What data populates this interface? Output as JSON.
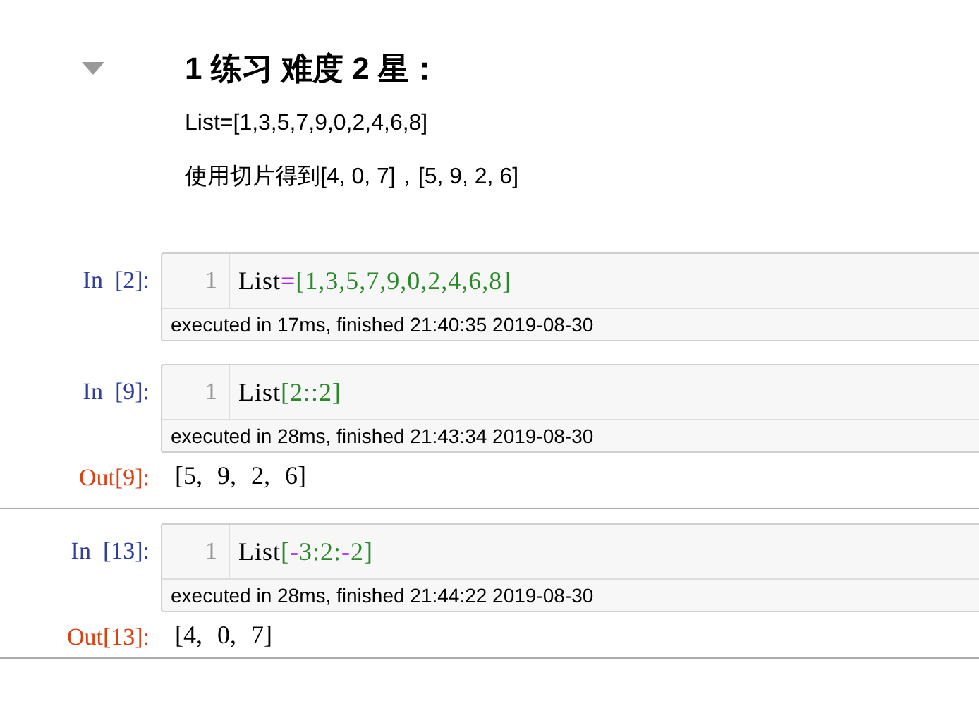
{
  "markdown": {
    "expanded": true,
    "heading": "1  练习 难度 2 星：",
    "paragraphs": [
      "List=[1,3,5,7,9,0,2,4,6,8]",
      "使用切片得到[4, 0, 7]，[5, 9, 2, 6]"
    ]
  },
  "cells": [
    {
      "selected": false,
      "prompt": "In  [2]:",
      "line_number": "1",
      "tokens": [
        {
          "kind": "name",
          "text": "List"
        },
        {
          "kind": "operator",
          "text": "="
        },
        {
          "kind": "number",
          "text": "[1,3,5,7,9,0,2,4,6,8]"
        }
      ],
      "timing": "executed in 17ms, finished 21:40:35 2019-08-30"
    },
    {
      "selected": false,
      "prompt": "In  [9]:",
      "line_number": "1",
      "tokens": [
        {
          "kind": "name",
          "text": "List"
        },
        {
          "kind": "number",
          "text": "[2::2]"
        }
      ],
      "timing": "executed in 28ms, finished 21:43:34 2019-08-30",
      "out_prompt": "Out[9]:",
      "output": "[5, 9, 2, 6]"
    },
    {
      "selected": true,
      "prompt": "In  [13]:",
      "line_number": "1",
      "tokens": [
        {
          "kind": "name",
          "text": "List"
        },
        {
          "kind": "number",
          "text": "["
        },
        {
          "kind": "operator",
          "text": "-"
        },
        {
          "kind": "number",
          "text": "3:2:"
        },
        {
          "kind": "operator",
          "text": "-"
        },
        {
          "kind": "number",
          "text": "2]"
        }
      ],
      "timing": "executed in 28ms, finished 21:44:22 2019-08-30",
      "out_prompt": "Out[13]:",
      "output": "[4, 0, 7]"
    }
  ]
}
